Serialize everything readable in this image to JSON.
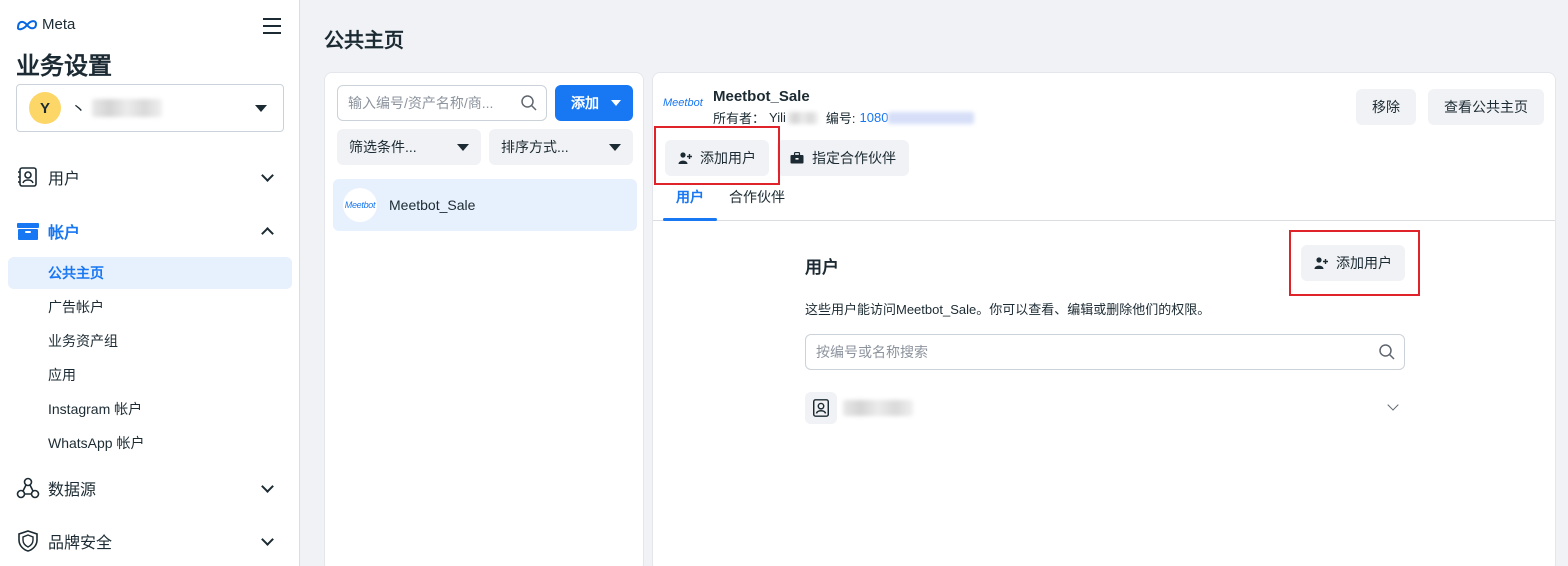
{
  "brand": {
    "name": "Meta"
  },
  "sidebar": {
    "title": "业务设置",
    "account": {
      "avatar_letter": "Y",
      "name_visible": "丶"
    },
    "groups": [
      {
        "label": "用户",
        "icon": "user-card-icon",
        "expanded": false
      },
      {
        "label": "帐户",
        "icon": "briefcase-icon",
        "expanded": true
      },
      {
        "label": "数据源",
        "icon": "data-sources-icon",
        "expanded": false
      },
      {
        "label": "品牌安全",
        "icon": "shield-icon",
        "expanded": false
      }
    ],
    "account_items": [
      "公共主页",
      "广告帐户",
      "业务资产组",
      "应用",
      "Instagram 帐户",
      "WhatsApp 帐户"
    ],
    "active_item": "公共主页"
  },
  "page": {
    "title": "公共主页"
  },
  "list": {
    "search_placeholder": "输入编号/资产名称/商...",
    "add_label": "添加",
    "filter_label": "筛选条件...",
    "sort_label": "排序方式...",
    "assets": [
      {
        "logo_text": "Meetbot",
        "name": "Meetbot_Sale"
      }
    ]
  },
  "detail": {
    "logo_text": "Meetbot",
    "name": "Meetbot_Sale",
    "owner_label": "所有者：",
    "owner_value": "Yili",
    "id_label": "编号:",
    "id_value": "1080",
    "remove_label": "移除",
    "view_page_label": "查看公共主页",
    "add_user_label": "添加用户",
    "assign_partner_label": "指定合作伙伴",
    "tabs": [
      "用户",
      "合作伙伴"
    ],
    "users_section": {
      "title": "用户",
      "add_user_label": "添加用户",
      "description": "这些用户能访问Meetbot_Sale。你可以查看、编辑或删除他们的权限。",
      "search_placeholder": "按编号或名称搜索"
    }
  },
  "colors": {
    "accent": "#1877f2",
    "highlight": "#e0232b",
    "avatar": "#fcd667"
  }
}
